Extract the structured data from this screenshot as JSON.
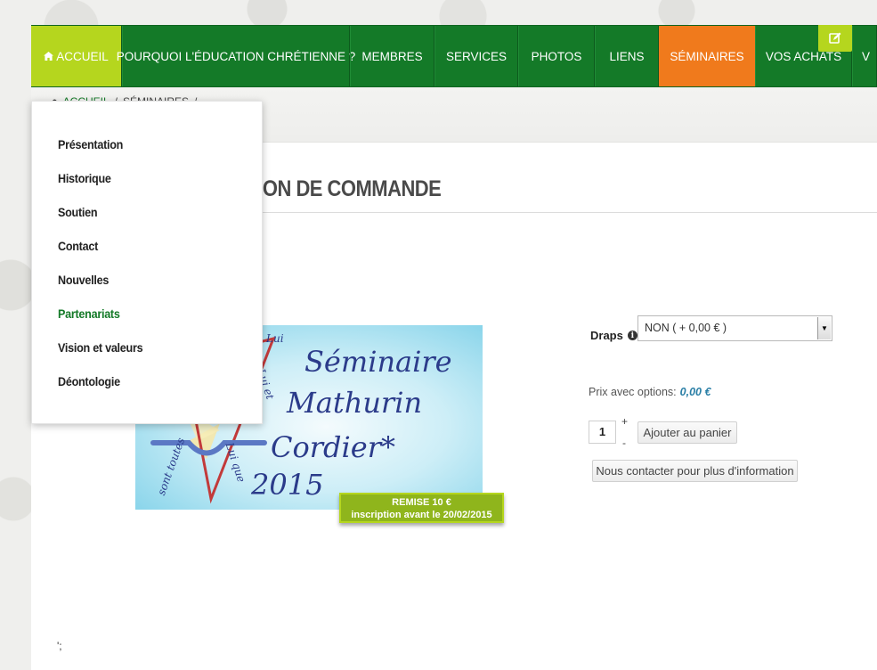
{
  "nav": {
    "items": [
      {
        "label": "ACCUEIL",
        "state": "home"
      },
      {
        "label": "POURQUOI L'ÉDUCATION CHRÉTIENNE ?",
        "state": "normal"
      },
      {
        "label": "MEMBRES",
        "state": "normal"
      },
      {
        "label": "SERVICES",
        "state": "normal"
      },
      {
        "label": "PHOTOS",
        "state": "normal"
      },
      {
        "label": "LIENS",
        "state": "normal"
      },
      {
        "label": "SÉMINAIRES",
        "state": "active"
      },
      {
        "label": "VOS ACHATS",
        "state": "normal"
      },
      {
        "label": "V",
        "state": "normal"
      }
    ],
    "colors": {
      "bar": "#147a28",
      "home": "#b5d61e",
      "active": "#f07a1c"
    }
  },
  "breadcrumb": {
    "home": "ACCUEIL",
    "separator": "/",
    "current": "SÉMINAIRES",
    "trail": "/"
  },
  "dropdown": {
    "items": [
      {
        "label": "Présentation",
        "active": false
      },
      {
        "label": "Historique",
        "active": false
      },
      {
        "label": "Soutien",
        "active": false
      },
      {
        "label": "Contact",
        "active": false
      },
      {
        "label": "Nouvelles",
        "active": false
      },
      {
        "label": "Partenariats",
        "active": true
      },
      {
        "label": "Vision et valeurs",
        "active": false
      },
      {
        "label": "Déontologie",
        "active": false
      }
    ]
  },
  "product": {
    "title": "ordier 2015 - BON DE COMMANDE",
    "image": {
      "line1": "Séminaire",
      "line2": "Mathurin",
      "line3": "Cordier*",
      "line4": "2015",
      "arc_text_1": "Lui",
      "arc_text_2": "par Lui et",
      "arc_text_3": "sont toutes",
      "arc_text_4": "Lui que"
    },
    "badge": {
      "line1": "REMISE 10 €",
      "line2": "inscription avant le 20/02/2015"
    },
    "options": {
      "draps_label": "Draps",
      "draps_value": "NON ( + 0,00 € )"
    },
    "price_label": "Prix avec options:",
    "price_value": "0,00 €",
    "quantity": "1",
    "qty_plus": "+",
    "qty_minus": "-",
    "add_to_cart": "Ajouter au panier",
    "contact": "Nous contacter pour plus d'information"
  },
  "footer_stray": "';"
}
